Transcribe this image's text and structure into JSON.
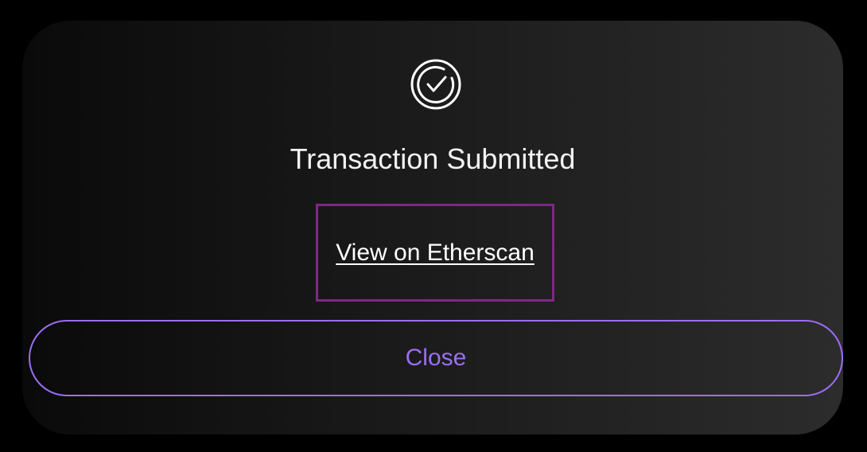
{
  "modal": {
    "title": "Transaction Submitted",
    "status_icon": "check-circle-icon",
    "link_label": "View on Etherscan",
    "close_label": "Close"
  },
  "colors": {
    "accent": "#9b6ef3",
    "highlight_border": "#7b2a82",
    "text": "#ffffff",
    "background": "#000000"
  }
}
